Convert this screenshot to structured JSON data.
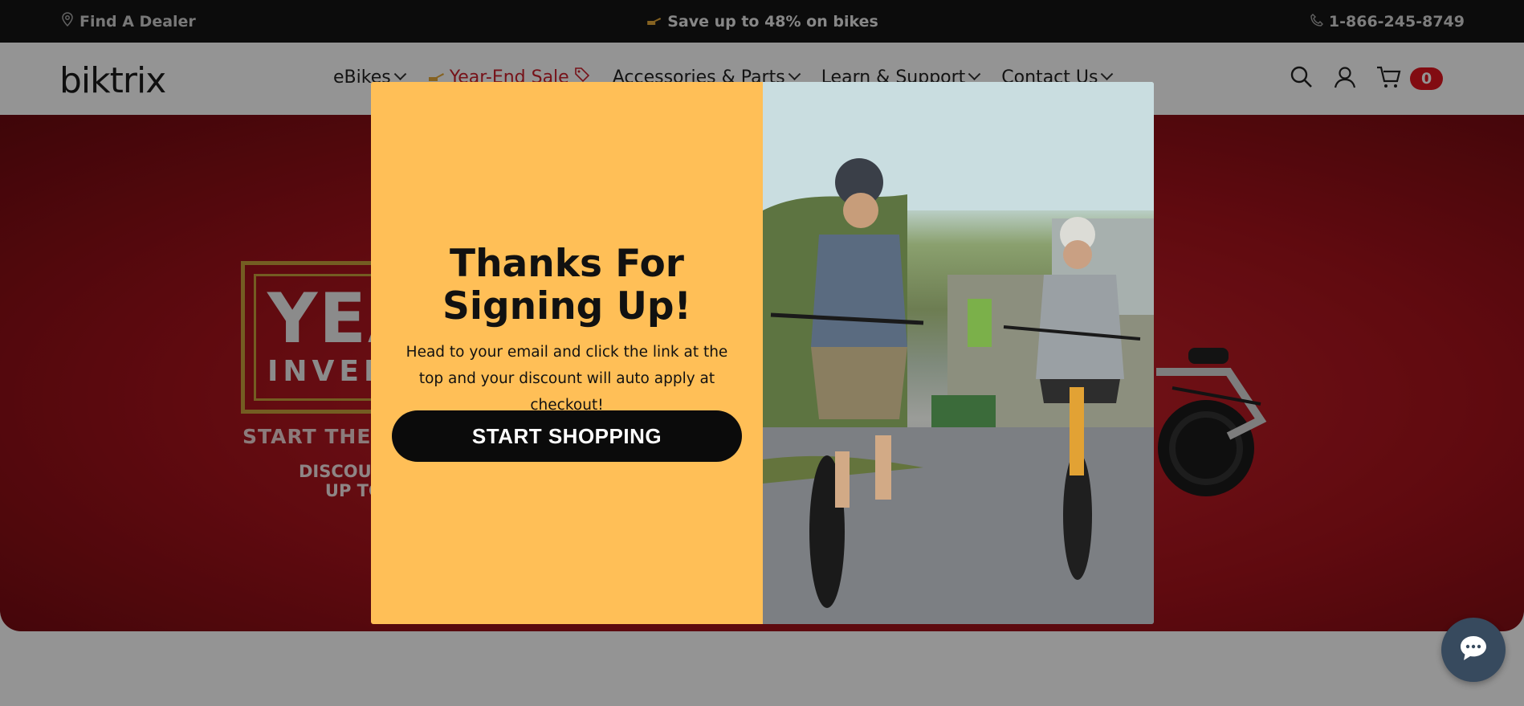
{
  "topbar": {
    "dealer_label": "Find A Dealer",
    "promo_label": "Save up to 48% on bikes",
    "phone_label": "1-866-245-8749"
  },
  "header": {
    "logo_text": "biktrix",
    "nav": [
      {
        "label": "eBikes"
      },
      {
        "label": "Year-End Sale"
      },
      {
        "label": "Accessories & Parts"
      },
      {
        "label": "Learn & Support"
      },
      {
        "label": "Contact Us"
      }
    ],
    "cart_count": "0"
  },
  "hero": {
    "badge_big": "YEAR",
    "badge_small": "INVENTORY",
    "line1": "START THE NEW YEAR",
    "line2a": "DISCOUNTS",
    "line2b": "UP TO"
  },
  "modal": {
    "title": "Thanks For\nSigning Up!",
    "body": "Head to your email and click the link at the top and your discount will auto apply at checkout!",
    "cta_label": "START SHOPPING"
  },
  "colors": {
    "modal_bg": "#ffbf57",
    "topbar_bg": "#151515",
    "hero_red": "#a5121b",
    "cart_badge": "#e0161f",
    "chat_button": "#374a5e"
  },
  "icons": [
    "location-pin-icon",
    "hand-point-icon",
    "phone-icon",
    "search-icon",
    "user-icon",
    "cart-icon",
    "tag-icon",
    "chat-bubble-icon"
  ]
}
